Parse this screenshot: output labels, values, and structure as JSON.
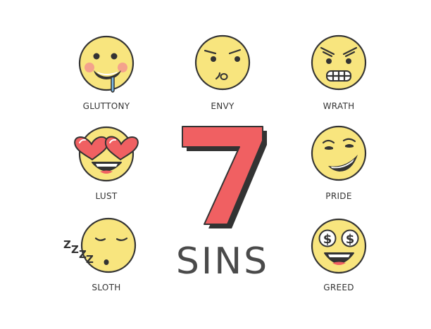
{
  "big_number": "7",
  "subtitle": "SINS",
  "faces": [
    {
      "id": "gluttony",
      "label": "GLUTTONY"
    },
    {
      "id": "envy",
      "label": "ENVY"
    },
    {
      "id": "wrath",
      "label": "WRATH"
    },
    {
      "id": "lust",
      "label": "LUST"
    },
    {
      "id": "pride",
      "label": "PRIDE"
    },
    {
      "id": "sloth",
      "label": "SLOTH"
    },
    {
      "id": "greed",
      "label": "GREED"
    }
  ],
  "sloth_zzz": "ZZZZ",
  "greed_symbol": "$",
  "colors": {
    "face_fill": "#f8e57e",
    "face_shadow": "#f0d35c",
    "outline": "#333333",
    "accent_red": "#f06062",
    "cheek": "#f4a28c",
    "drool": "#7ab8e8"
  }
}
